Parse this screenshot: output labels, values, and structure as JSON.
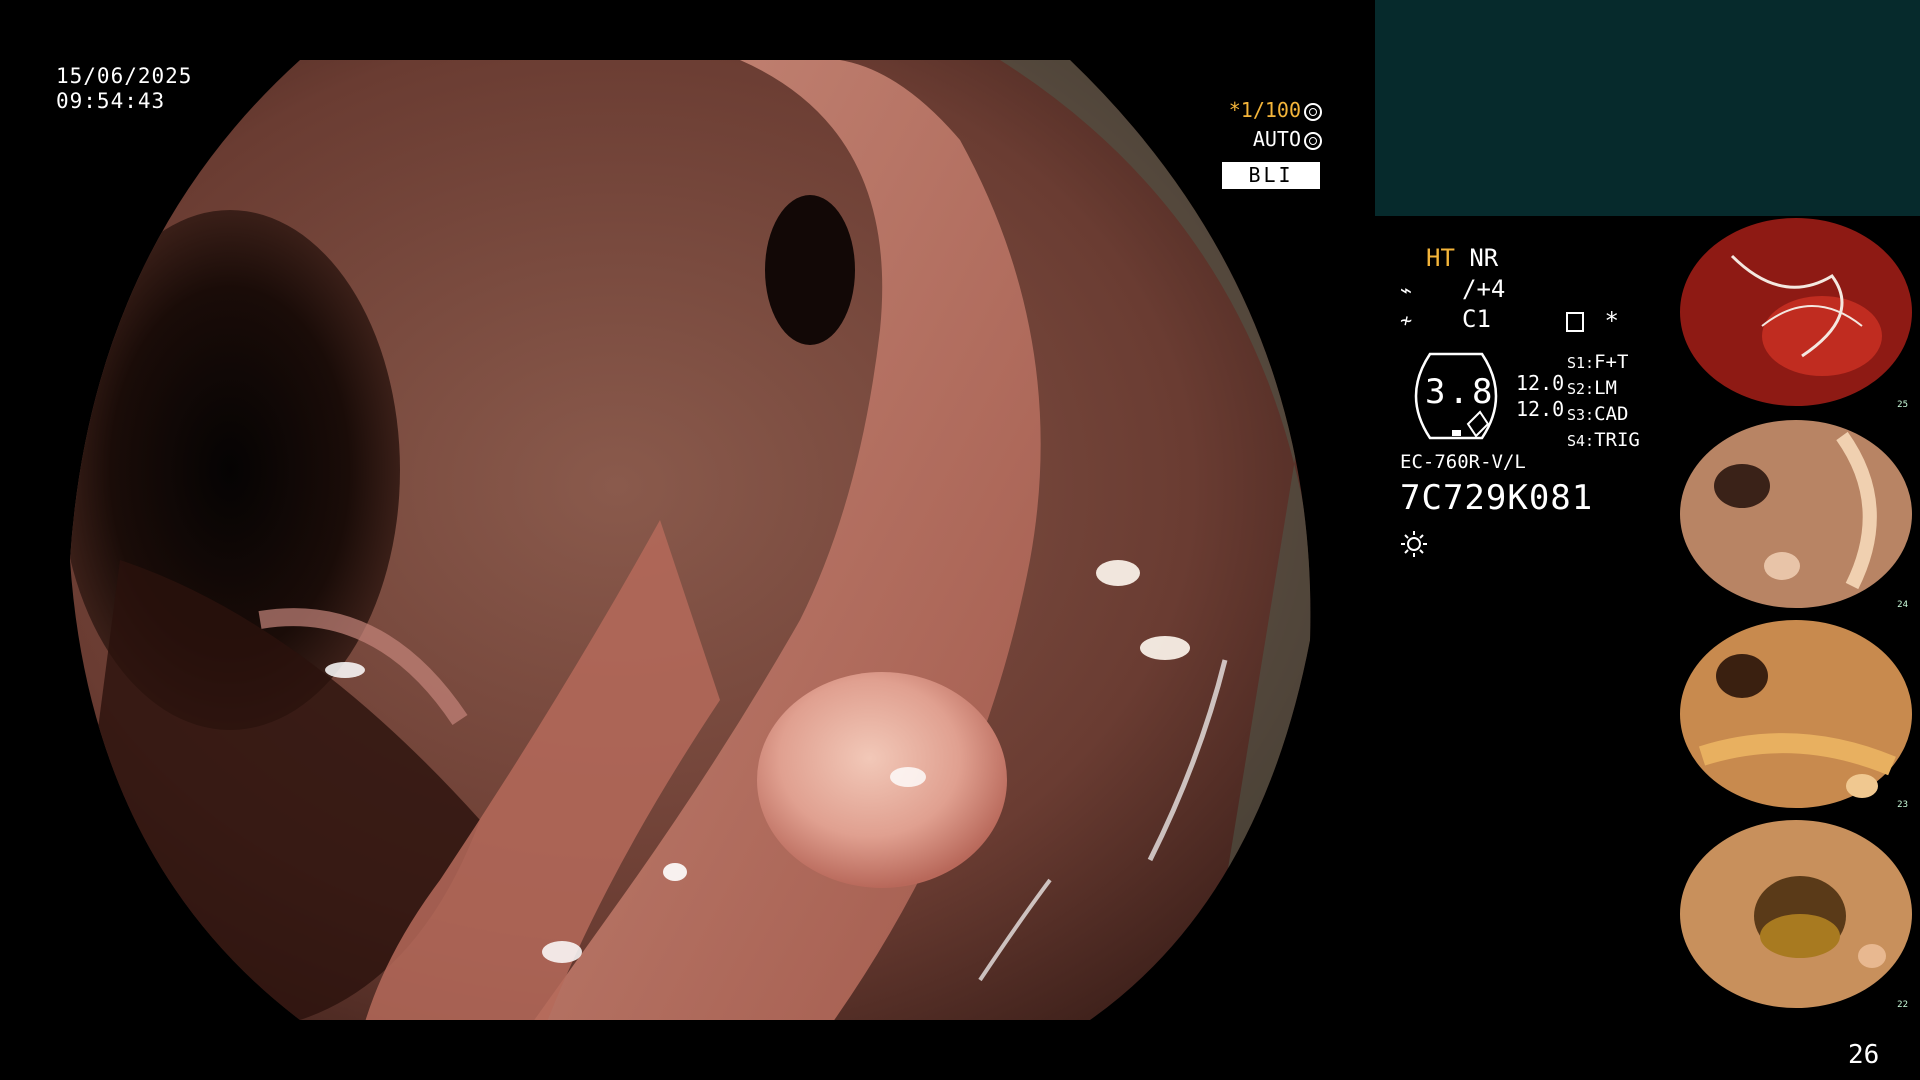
{
  "overlay": {
    "date": "15/06/2025",
    "time": "09:54:43",
    "shutter_speed": "*1/100",
    "iris_mode": "AUTO",
    "light_mode": "BLI"
  },
  "panel": {
    "ht_label": "HT",
    "nr_label": "NR",
    "enhance_value": "/+4",
    "color_value": "C1",
    "star": "*",
    "pressure_value": "3.8",
    "scale_top": "12.0",
    "scale_bottom": "12.0",
    "switches": [
      {
        "key": "S1:",
        "value": "F+T"
      },
      {
        "key": "S2:",
        "value": "LM"
      },
      {
        "key": "S3:",
        "value": "CAD"
      },
      {
        "key": "S4:",
        "value": "TRIG"
      }
    ],
    "scope_model": "EC-760R-V/L",
    "serial": "7C729K081"
  },
  "thumbnails": [
    {
      "number": "25"
    },
    {
      "number": "24"
    },
    {
      "number": "23"
    },
    {
      "number": "22"
    }
  ],
  "page_number": "26",
  "colors": {
    "accent_yellow": "#f4b53a",
    "panel_teal": "#062a2c"
  }
}
